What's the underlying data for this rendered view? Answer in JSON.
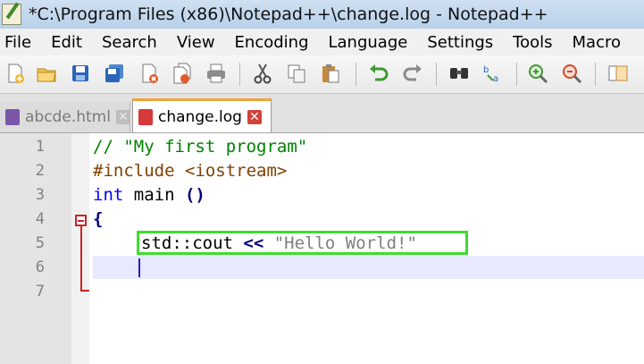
{
  "window": {
    "title": "*C:\\Program Files (x86)\\Notepad++\\change.log - Notepad++"
  },
  "menu": {
    "items": [
      "File",
      "Edit",
      "Search",
      "View",
      "Encoding",
      "Language",
      "Settings",
      "Tools",
      "Macro"
    ]
  },
  "toolbar": {
    "icons": [
      "new-file-icon",
      "open-file-icon",
      "save-icon",
      "save-all-icon",
      "close-icon",
      "close-all-icon",
      "print-icon",
      "cut-icon",
      "copy-icon",
      "paste-icon",
      "undo-icon",
      "redo-icon",
      "find-icon",
      "replace-icon",
      "zoom-in-icon",
      "zoom-out-icon",
      "sync-scroll-icon"
    ]
  },
  "tabs": [
    {
      "label": "abcde.html",
      "active": false,
      "icon_color": "#7a56a8"
    },
    {
      "label": "change.log",
      "active": true,
      "icon_color": "#d63a3a"
    }
  ],
  "editor": {
    "line_numbers": [
      "1",
      "2",
      "3",
      "4",
      "5",
      "6",
      "7"
    ],
    "lines": {
      "l1": {
        "comment": "// \"My first program\""
      },
      "l2": {
        "pre": "#include <iostream>"
      },
      "l3": {
        "kw": "int",
        "rest": " main ",
        "paren": "()"
      },
      "l4": {
        "brace": "{"
      },
      "l5": {
        "ident": "std::cout ",
        "op": "<<",
        "space": " ",
        "str": "\"Hello World!\""
      }
    }
  },
  "colors": {
    "highlight_box": "#3ddd2f",
    "fold_marker": "#cc2222",
    "current_line": "#e8e8ff"
  }
}
